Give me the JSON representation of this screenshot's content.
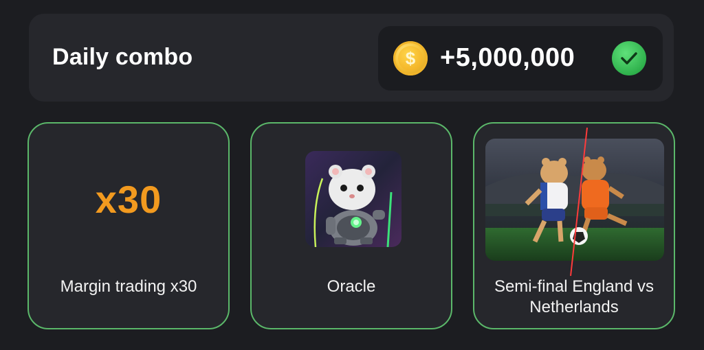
{
  "header": {
    "title": "Daily combo",
    "reward": {
      "coin_icon": "coin-icon",
      "coin_symbol": "$",
      "amount": "+5,000,000",
      "status_icon": "checkmark-icon"
    }
  },
  "cards": [
    {
      "label": "Margin trading x30",
      "graphic_text": "x30",
      "graphic_color": "#f29a1f"
    },
    {
      "label": "Oracle",
      "image": "hamster-robot-image"
    },
    {
      "label_line1": "Semi-final England vs",
      "label_line2": "Netherlands",
      "image": "hamsters-football-image"
    }
  ],
  "colors": {
    "card_border": "#5bb86a",
    "accent_check": "#2fb14c",
    "background": "#1c1d21"
  }
}
